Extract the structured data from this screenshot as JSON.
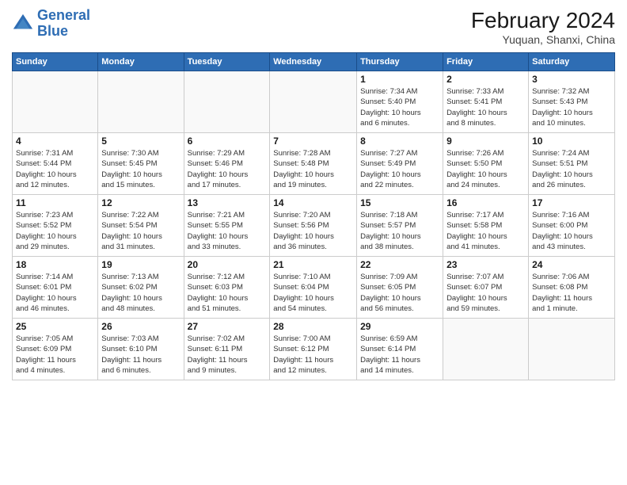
{
  "header": {
    "logo_line1": "General",
    "logo_line2": "Blue",
    "month_year": "February 2024",
    "location": "Yuquan, Shanxi, China"
  },
  "weekdays": [
    "Sunday",
    "Monday",
    "Tuesday",
    "Wednesday",
    "Thursday",
    "Friday",
    "Saturday"
  ],
  "weeks": [
    [
      {
        "day": "",
        "info": ""
      },
      {
        "day": "",
        "info": ""
      },
      {
        "day": "",
        "info": ""
      },
      {
        "day": "",
        "info": ""
      },
      {
        "day": "1",
        "info": "Sunrise: 7:34 AM\nSunset: 5:40 PM\nDaylight: 10 hours\nand 6 minutes."
      },
      {
        "day": "2",
        "info": "Sunrise: 7:33 AM\nSunset: 5:41 PM\nDaylight: 10 hours\nand 8 minutes."
      },
      {
        "day": "3",
        "info": "Sunrise: 7:32 AM\nSunset: 5:43 PM\nDaylight: 10 hours\nand 10 minutes."
      }
    ],
    [
      {
        "day": "4",
        "info": "Sunrise: 7:31 AM\nSunset: 5:44 PM\nDaylight: 10 hours\nand 12 minutes."
      },
      {
        "day": "5",
        "info": "Sunrise: 7:30 AM\nSunset: 5:45 PM\nDaylight: 10 hours\nand 15 minutes."
      },
      {
        "day": "6",
        "info": "Sunrise: 7:29 AM\nSunset: 5:46 PM\nDaylight: 10 hours\nand 17 minutes."
      },
      {
        "day": "7",
        "info": "Sunrise: 7:28 AM\nSunset: 5:48 PM\nDaylight: 10 hours\nand 19 minutes."
      },
      {
        "day": "8",
        "info": "Sunrise: 7:27 AM\nSunset: 5:49 PM\nDaylight: 10 hours\nand 22 minutes."
      },
      {
        "day": "9",
        "info": "Sunrise: 7:26 AM\nSunset: 5:50 PM\nDaylight: 10 hours\nand 24 minutes."
      },
      {
        "day": "10",
        "info": "Sunrise: 7:24 AM\nSunset: 5:51 PM\nDaylight: 10 hours\nand 26 minutes."
      }
    ],
    [
      {
        "day": "11",
        "info": "Sunrise: 7:23 AM\nSunset: 5:52 PM\nDaylight: 10 hours\nand 29 minutes."
      },
      {
        "day": "12",
        "info": "Sunrise: 7:22 AM\nSunset: 5:54 PM\nDaylight: 10 hours\nand 31 minutes."
      },
      {
        "day": "13",
        "info": "Sunrise: 7:21 AM\nSunset: 5:55 PM\nDaylight: 10 hours\nand 33 minutes."
      },
      {
        "day": "14",
        "info": "Sunrise: 7:20 AM\nSunset: 5:56 PM\nDaylight: 10 hours\nand 36 minutes."
      },
      {
        "day": "15",
        "info": "Sunrise: 7:18 AM\nSunset: 5:57 PM\nDaylight: 10 hours\nand 38 minutes."
      },
      {
        "day": "16",
        "info": "Sunrise: 7:17 AM\nSunset: 5:58 PM\nDaylight: 10 hours\nand 41 minutes."
      },
      {
        "day": "17",
        "info": "Sunrise: 7:16 AM\nSunset: 6:00 PM\nDaylight: 10 hours\nand 43 minutes."
      }
    ],
    [
      {
        "day": "18",
        "info": "Sunrise: 7:14 AM\nSunset: 6:01 PM\nDaylight: 10 hours\nand 46 minutes."
      },
      {
        "day": "19",
        "info": "Sunrise: 7:13 AM\nSunset: 6:02 PM\nDaylight: 10 hours\nand 48 minutes."
      },
      {
        "day": "20",
        "info": "Sunrise: 7:12 AM\nSunset: 6:03 PM\nDaylight: 10 hours\nand 51 minutes."
      },
      {
        "day": "21",
        "info": "Sunrise: 7:10 AM\nSunset: 6:04 PM\nDaylight: 10 hours\nand 54 minutes."
      },
      {
        "day": "22",
        "info": "Sunrise: 7:09 AM\nSunset: 6:05 PM\nDaylight: 10 hours\nand 56 minutes."
      },
      {
        "day": "23",
        "info": "Sunrise: 7:07 AM\nSunset: 6:07 PM\nDaylight: 10 hours\nand 59 minutes."
      },
      {
        "day": "24",
        "info": "Sunrise: 7:06 AM\nSunset: 6:08 PM\nDaylight: 11 hours\nand 1 minute."
      }
    ],
    [
      {
        "day": "25",
        "info": "Sunrise: 7:05 AM\nSunset: 6:09 PM\nDaylight: 11 hours\nand 4 minutes."
      },
      {
        "day": "26",
        "info": "Sunrise: 7:03 AM\nSunset: 6:10 PM\nDaylight: 11 hours\nand 6 minutes."
      },
      {
        "day": "27",
        "info": "Sunrise: 7:02 AM\nSunset: 6:11 PM\nDaylight: 11 hours\nand 9 minutes."
      },
      {
        "day": "28",
        "info": "Sunrise: 7:00 AM\nSunset: 6:12 PM\nDaylight: 11 hours\nand 12 minutes."
      },
      {
        "day": "29",
        "info": "Sunrise: 6:59 AM\nSunset: 6:14 PM\nDaylight: 11 hours\nand 14 minutes."
      },
      {
        "day": "",
        "info": ""
      },
      {
        "day": "",
        "info": ""
      }
    ]
  ]
}
